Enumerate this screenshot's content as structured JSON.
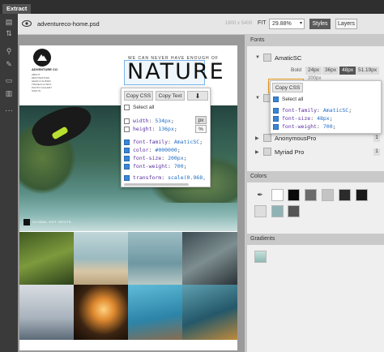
{
  "app": {
    "tab_label": "Extract"
  },
  "toolbar": {
    "file_name": "adventureco-home.psd",
    "dimensions": "1600 x 5400",
    "fit_label": "FIT",
    "zoom": "29.88%",
    "styles_label": "Styles",
    "layers_label": "Layers"
  },
  "page": {
    "logo_name": "ADVENTURE CO",
    "nav_items": [
      "ABOUT",
      "DESTINATIONS",
      "GEAR & GUIDES",
      "TRAVELS & INFO",
      "PHOTO GALLERY",
      "SIGN IN"
    ],
    "hero_small": "WE CAN NEVER HAVE ENOUGH OF",
    "hero_big": "NATURE",
    "section_label": "GLOBAL HOT SPOTS"
  },
  "css_popup": {
    "copy_css": "Copy CSS",
    "copy_text": "Copy Text",
    "select_all": "Select all",
    "unit_px": "px",
    "unit_pct": "%",
    "props": [
      {
        "key": "width",
        "value": "534px",
        "checked": false
      },
      {
        "key": "height",
        "value": "136px",
        "checked": false
      },
      {
        "key": "font-family",
        "value": "AmaticSC",
        "checked": true
      },
      {
        "key": "color",
        "value": "#000000",
        "checked": true
      },
      {
        "key": "font-size",
        "value": "200px",
        "checked": true
      },
      {
        "key": "font-weight",
        "value": "700",
        "checked": true
      },
      {
        "key": "transform",
        "value": "scale(0.968,",
        "checked": true
      }
    ]
  },
  "panel": {
    "fonts_title": "Fonts",
    "font_name": "AmaticSC",
    "font_weight": "Bold",
    "sizes": [
      "24px",
      "36px",
      "48px",
      "51.19px"
    ],
    "size_selected": "48px",
    "size_extra": "200px",
    "font_rows": [
      {
        "name": "AnonymousPro",
        "count": "1"
      },
      {
        "name": "Myriad Pro",
        "count": "1"
      }
    ],
    "collapsed_count": "1",
    "colors_title": "Colors",
    "gradients_title": "Gradients",
    "colors_row1": [
      "#ffffff",
      "#0a0a0a",
      "#6b6b6b",
      "#c4c4c4",
      "#2b2b2b",
      "#1a1a1a"
    ],
    "colors_row2": [
      "#dedede",
      "#8fb3b5",
      "#555555"
    ],
    "accent": "#f0a020"
  },
  "panel_popup": {
    "copy_css": "Copy CSS",
    "select_all": "Select all",
    "props": [
      {
        "key": "font-family",
        "value": "AmaticSC"
      },
      {
        "key": "font-size",
        "value": "48px"
      },
      {
        "key": "font-weight",
        "value": "700"
      }
    ]
  }
}
